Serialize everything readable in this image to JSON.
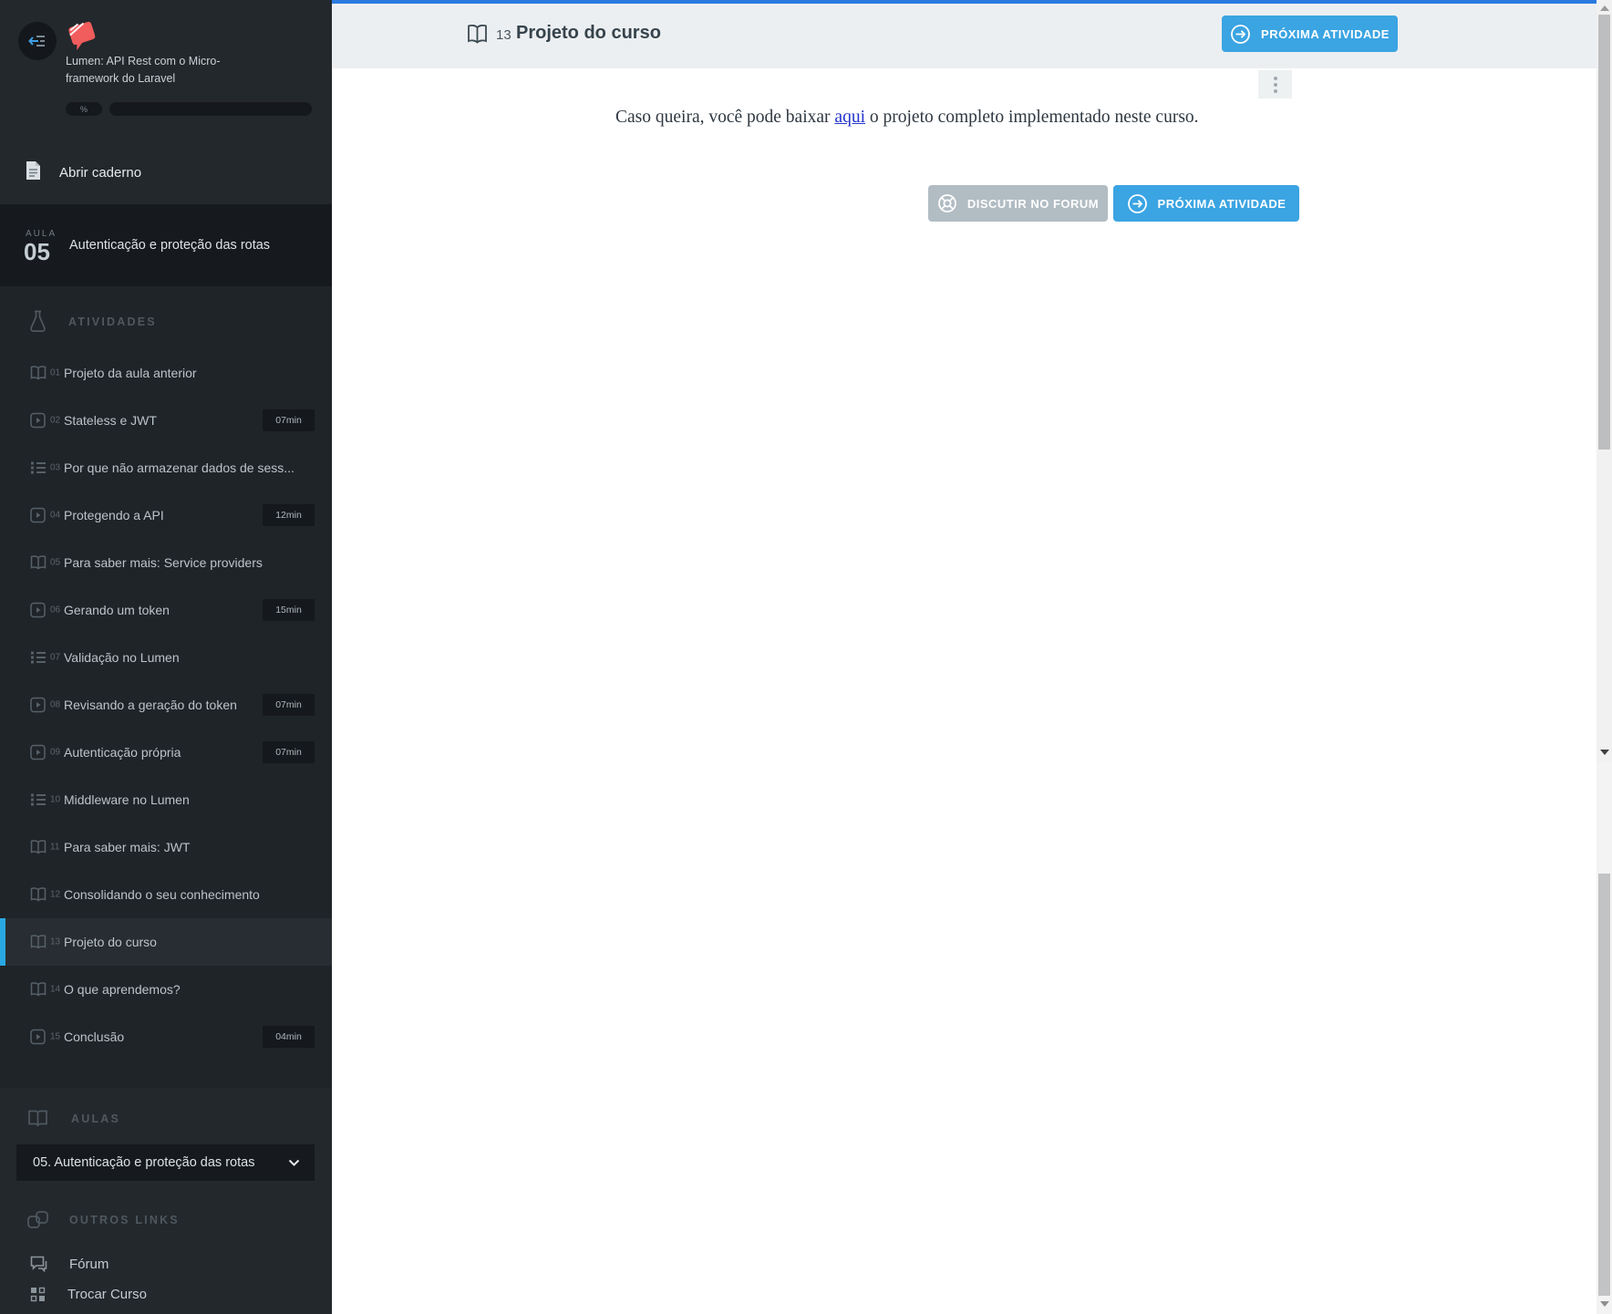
{
  "colors": {
    "top_line": "#2a7ae0",
    "accent_blue": "#3ba4e2",
    "selection_blue": "#29a8e2",
    "link_blue": "#2433cc",
    "logo_red": "#f15c5c",
    "sidebar_bg": "#23282c",
    "sidebar_dark": "#16191d",
    "header_bg": "#eceff1",
    "forum_button_gray": "#b1bcc3"
  },
  "sidebar": {
    "course_title_lines": [
      "Lumen: API Rest com o Micro-",
      "framework do Laravel"
    ],
    "progress_label": "%",
    "notebook_label": "Abrir caderno",
    "lesson_badge": {
      "label": "AULA",
      "number": "05",
      "title": "Autenticação e proteção das rotas"
    },
    "activities_header": "ATIVIDADES",
    "activities": [
      {
        "num": "01",
        "label": "Projeto da aula anterior",
        "icon": "book",
        "duration": "",
        "selected": false
      },
      {
        "num": "02",
        "label": "Stateless e JWT",
        "icon": "video",
        "duration": "07min",
        "selected": false
      },
      {
        "num": "03",
        "label": "Por que não armazenar dados de sess...",
        "icon": "list",
        "duration": "",
        "selected": false
      },
      {
        "num": "04",
        "label": "Protegendo a API",
        "icon": "video",
        "duration": "12min",
        "selected": false
      },
      {
        "num": "05",
        "label": "Para saber mais: Service providers",
        "icon": "book",
        "duration": "",
        "selected": false
      },
      {
        "num": "06",
        "label": "Gerando um token",
        "icon": "video",
        "duration": "15min",
        "selected": false
      },
      {
        "num": "07",
        "label": "Validação no Lumen",
        "icon": "list",
        "duration": "",
        "selected": false
      },
      {
        "num": "08",
        "label": "Revisando a geração do token",
        "icon": "video",
        "duration": "07min",
        "selected": false
      },
      {
        "num": "09",
        "label": "Autenticação própria",
        "icon": "video",
        "duration": "07min",
        "selected": false
      },
      {
        "num": "10",
        "label": "Middleware no Lumen",
        "icon": "list",
        "duration": "",
        "selected": false
      },
      {
        "num": "11",
        "label": "Para saber mais: JWT",
        "icon": "book",
        "duration": "",
        "selected": false
      },
      {
        "num": "12",
        "label": "Consolidando o seu conhecimento",
        "icon": "book",
        "duration": "",
        "selected": false
      },
      {
        "num": "13",
        "label": "Projeto do curso",
        "icon": "book",
        "duration": "",
        "selected": true
      },
      {
        "num": "14",
        "label": "O que aprendemos?",
        "icon": "book",
        "duration": "",
        "selected": false
      },
      {
        "num": "15",
        "label": "Conclusão",
        "icon": "video",
        "duration": "04min",
        "selected": false
      }
    ],
    "lessons_header": "AULAS",
    "lesson_select_value": "05. Autenticação e proteção das rotas",
    "other_links_header": "OUTROS LINKS",
    "other_links": [
      {
        "label": "Fórum",
        "icon": "forum"
      },
      {
        "label": "Trocar Curso",
        "icon": "grid"
      }
    ]
  },
  "header": {
    "activity_number": "13",
    "title": "Projeto do curso",
    "next_button_label": "PRÓXIMA ATIVIDADE"
  },
  "content": {
    "paragraph_before": "Caso queira, você pode baixar ",
    "link_text": "aqui",
    "paragraph_after": " o projeto completo implementado neste curso.",
    "forum_button_label": "DISCUTIR NO FORUM",
    "next_button_label": "PRÓXIMA ATIVIDADE"
  }
}
